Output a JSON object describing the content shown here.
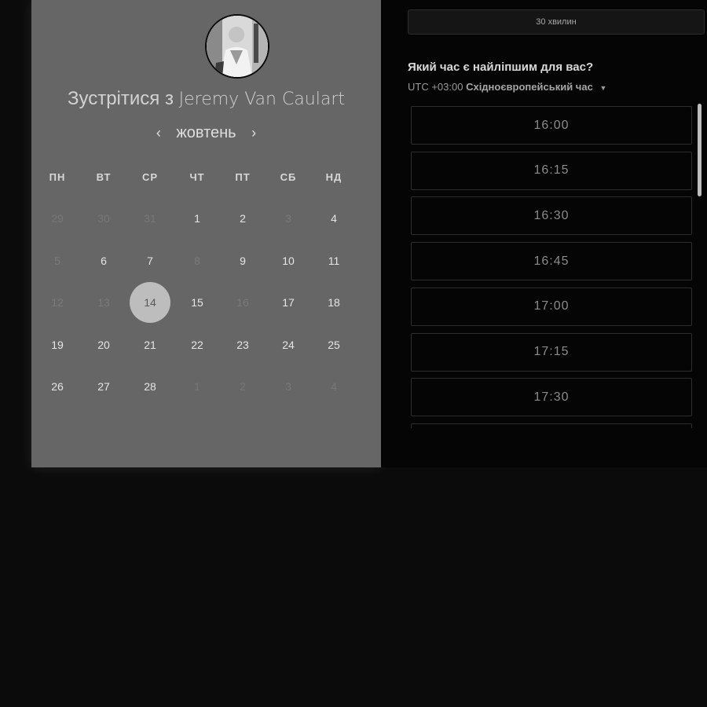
{
  "calendar": {
    "title_prefix": "Зустрітися з",
    "host_name": "Jeremy Van Caulart",
    "month_label": "жовтень",
    "prev_icon": "chevron-left-icon",
    "next_icon": "chevron-right-icon",
    "weekdays": [
      "ПН",
      "ВТ",
      "СР",
      "ЧТ",
      "ПТ",
      "СБ",
      "НД"
    ],
    "weeks": [
      [
        {
          "label": "29",
          "state": "other"
        },
        {
          "label": "30",
          "state": "other"
        },
        {
          "label": "31",
          "state": "other"
        },
        {
          "label": "1",
          "state": "available"
        },
        {
          "label": "2",
          "state": "available"
        },
        {
          "label": "3",
          "state": "muted"
        },
        {
          "label": "4",
          "state": "available"
        }
      ],
      [
        {
          "label": "5",
          "state": "muted"
        },
        {
          "label": "6",
          "state": "available"
        },
        {
          "label": "7",
          "state": "available"
        },
        {
          "label": "8",
          "state": "muted"
        },
        {
          "label": "9",
          "state": "available"
        },
        {
          "label": "10",
          "state": "available"
        },
        {
          "label": "11",
          "state": "available"
        }
      ],
      [
        {
          "label": "12",
          "state": "muted"
        },
        {
          "label": "13",
          "state": "muted"
        },
        {
          "label": "14",
          "state": "selected"
        },
        {
          "label": "15",
          "state": "available"
        },
        {
          "label": "16",
          "state": "muted"
        },
        {
          "label": "17",
          "state": "available"
        },
        {
          "label": "18",
          "state": "available"
        }
      ],
      [
        {
          "label": "19",
          "state": "available"
        },
        {
          "label": "20",
          "state": "available"
        },
        {
          "label": "21",
          "state": "available"
        },
        {
          "label": "22",
          "state": "available"
        },
        {
          "label": "23",
          "state": "available"
        },
        {
          "label": "24",
          "state": "available"
        },
        {
          "label": "25",
          "state": "available"
        }
      ],
      [
        {
          "label": "26",
          "state": "available"
        },
        {
          "label": "27",
          "state": "available"
        },
        {
          "label": "28",
          "state": "available"
        },
        {
          "label": "1",
          "state": "other"
        },
        {
          "label": "2",
          "state": "other"
        },
        {
          "label": "3",
          "state": "other"
        },
        {
          "label": "4",
          "state": "other"
        }
      ]
    ]
  },
  "booking": {
    "duration": "30 хвилин",
    "question": "Який час є найліпшим для вас?",
    "timezone_offset": "UTC +03:00",
    "timezone_name": "Східноєвропейський час",
    "timezone_caret_icon": "caret-down-icon",
    "slots": [
      "16:00",
      "16:15",
      "16:30",
      "16:45",
      "17:00",
      "17:15",
      "17:30"
    ]
  },
  "colors": {
    "page_background": "#0b0b0b",
    "calendar_panel": "#666666",
    "selected_day": "#bdbdbd",
    "slot_border": "#2e2e2e"
  }
}
